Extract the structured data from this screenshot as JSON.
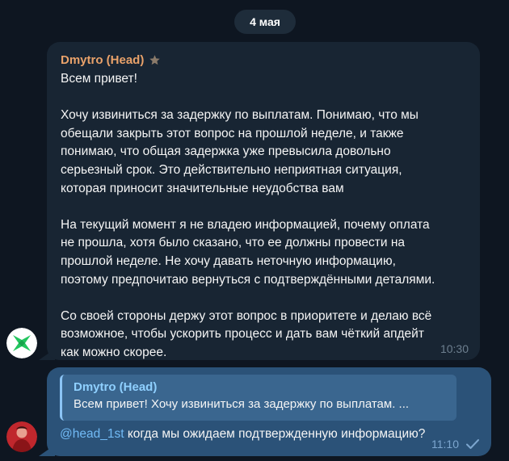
{
  "date_label": "4 мая",
  "messages": [
    {
      "sender": "Dmytro (Head)",
      "sender_badge": "star-icon",
      "paragraphs": [
        "Всем привет!",
        "Хочу извиниться за задержку по выплатам. Понимаю, что мы\nобещали закрыть этот вопрос на прошлой неделе, и также\nпонимаю, что общая задержка уже превысила довольно\nсерьезный срок. Это действительно неприятная ситуация,\nкоторая приносит значительные неудобства вам",
        "На текущий момент я не владею информацией, почему оплата\nне прошла, хотя было сказано, что ее должны провести на\nпрошлой неделе. Не хочу давать неточную информацию,\nпоэтому предпочитаю вернуться с подтверждёнными деталями.",
        "Со своей стороны держу этот вопрос в приоритете и делаю всё\nвозможное, чтобы ускорить процесс и дать вам чёткий апдейт\nкак можно скорее."
      ],
      "time": "10:30"
    },
    {
      "reply_to": {
        "sender": "Dmytro (Head)",
        "preview": "Всем привет!  Хочу извиниться за задержку по выплатам. ..."
      },
      "mention": "@head_1st",
      "text": " когда мы ожидаем подтвержденную информацию?",
      "time": "11:10",
      "status_icon": "check-icon"
    }
  ],
  "colors": {
    "background": "#0e1621",
    "incoming_bubble": "#182533",
    "outgoing_bubble": "#2b5278",
    "sender_name": "#e9a26a",
    "reply_name": "#8fd0ff",
    "mention": "#71baf5"
  }
}
